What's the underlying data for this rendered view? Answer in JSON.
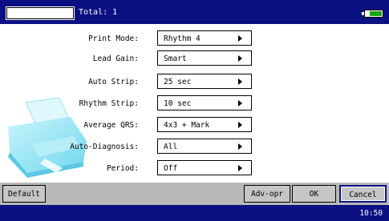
{
  "header": {
    "id_value": "",
    "total_text": "Total: 1"
  },
  "settings": [
    {
      "label": "Print Mode:",
      "value": "Rhythm 4"
    },
    {
      "label": "Lead Gain:",
      "value": "Smart"
    },
    {
      "label": "Auto Strip:",
      "value": "25 sec"
    },
    {
      "label": "Rhythm Strip:",
      "value": "10 sec"
    },
    {
      "label": "Average QRS:",
      "value": "4x3 + Mark"
    },
    {
      "label": "Auto-Diagnosis:",
      "value": "All"
    },
    {
      "label": "Period:",
      "value": "Off"
    }
  ],
  "buttons": {
    "default": "Default",
    "adv_opr": "Adv-opr",
    "ok": "OK",
    "cancel": "Cancel"
  },
  "status": {
    "time": "10:50"
  },
  "colors": {
    "bar_blue": "#0b1183",
    "button_gray": "#c6c6c6",
    "battery_green": "#1aa51a",
    "printer_cyan": "#8ee6f5"
  }
}
